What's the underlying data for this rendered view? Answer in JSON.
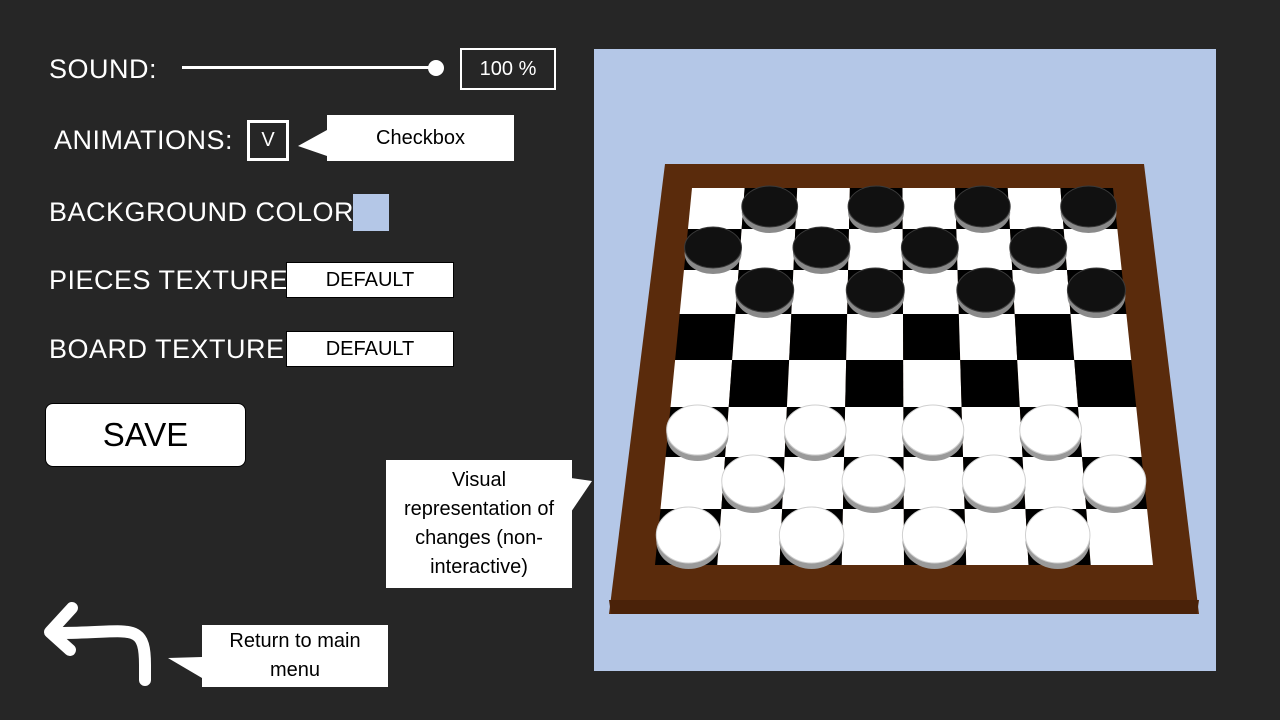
{
  "settings": {
    "sound": {
      "label": "SOUND:",
      "value": 1.0,
      "display": "100 %"
    },
    "animations": {
      "label": "ANIMATIONS:",
      "mark": "V",
      "checked": true
    },
    "background_color": {
      "label": "BACKGROUND COLOR:",
      "color": "#b4c7e7"
    },
    "pieces_texture": {
      "label": "PIECES TEXTURE:",
      "value": "DEFAULT"
    },
    "board_texture": {
      "label": "BOARD TEXTURE:",
      "value": "DEFAULT"
    }
  },
  "save_label": "SAVE",
  "callouts": {
    "checkbox": "Checkbox",
    "preview": "Visual representation of changes (non-interactive)",
    "back": "Return to main menu"
  },
  "icons": {
    "back": "return-arrow-icon"
  },
  "colors": {
    "page_bg": "#262626",
    "preview_bg": "#b4c7e7",
    "board_frame": "#5a2b0c",
    "dark_square": "#000000",
    "light_square": "#ffffff",
    "dark_piece": "#111111",
    "light_piece": "#ffffff"
  },
  "board": {
    "size": 8,
    "dark_piece_rows": [
      0,
      1,
      2
    ],
    "light_piece_rows": [
      5,
      6,
      7
    ]
  }
}
